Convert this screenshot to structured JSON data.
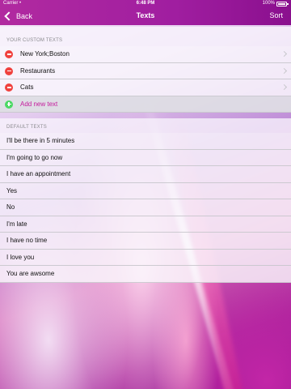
{
  "status": {
    "carrier": "Carrier",
    "wifi_icon": "wifi-icon",
    "time": "6:48 PM",
    "battery": "100%"
  },
  "navbar": {
    "back_label": "Back",
    "title": "Texts",
    "sort_label": "Sort"
  },
  "custom": {
    "header": "YOUR CUSTOM TEXTS",
    "items": [
      {
        "label": "New York;Boston"
      },
      {
        "label": "Restaurants"
      },
      {
        "label": "Cats"
      }
    ],
    "add_label": "Add new text"
  },
  "defaults": {
    "header": "DEFAULT TEXTS",
    "items": [
      {
        "label": "I'll be there in 5 minutes"
      },
      {
        "label": "I'm going to go now"
      },
      {
        "label": "I have an appointment"
      },
      {
        "label": "Yes"
      },
      {
        "label": "No"
      },
      {
        "label": "I'm late"
      },
      {
        "label": "I have no time"
      },
      {
        "label": "I love you"
      },
      {
        "label": "You are awsome"
      }
    ]
  },
  "colors": {
    "navbar": "#a01ea0",
    "accent": "#c41b9c",
    "delete": "#f0413d",
    "add": "#4cd964"
  }
}
